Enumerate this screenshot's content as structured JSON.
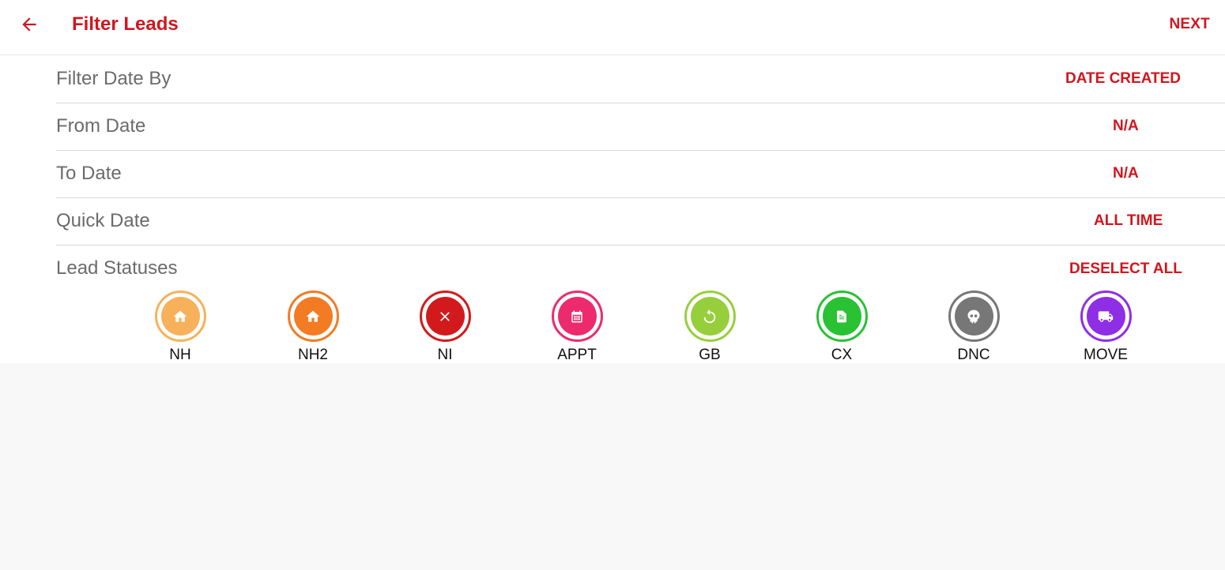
{
  "header": {
    "title": "Filter Leads",
    "next_label": "NEXT",
    "accent_color": "#d0161e"
  },
  "filters": [
    {
      "label": "Filter Date By",
      "value": "DATE CREATED"
    },
    {
      "label": "From Date",
      "value": "N/A"
    },
    {
      "label": "To Date",
      "value": "N/A"
    },
    {
      "label": "Quick Date",
      "value": "ALL TIME"
    }
  ],
  "lead_statuses": {
    "label": "Lead Statuses",
    "action_label": "DESELECT ALL",
    "items": [
      {
        "label": "NH",
        "icon": "home-icon",
        "color": "#f7b15a"
      },
      {
        "label": "NH2",
        "icon": "home-icon",
        "color": "#f27b23"
      },
      {
        "label": "NI",
        "icon": "close-icon",
        "color": "#d21a1d"
      },
      {
        "label": "APPT",
        "icon": "calendar-icon",
        "color": "#ec2a6c"
      },
      {
        "label": "GB",
        "icon": "refresh-icon",
        "color": "#96cf3b"
      },
      {
        "label": "CX",
        "icon": "receipt-icon",
        "color": "#28c232"
      },
      {
        "label": "DNC",
        "icon": "skull-icon",
        "color": "#777777"
      },
      {
        "label": "MOVE",
        "icon": "truck-icon",
        "color": "#8e2fe6"
      }
    ]
  }
}
